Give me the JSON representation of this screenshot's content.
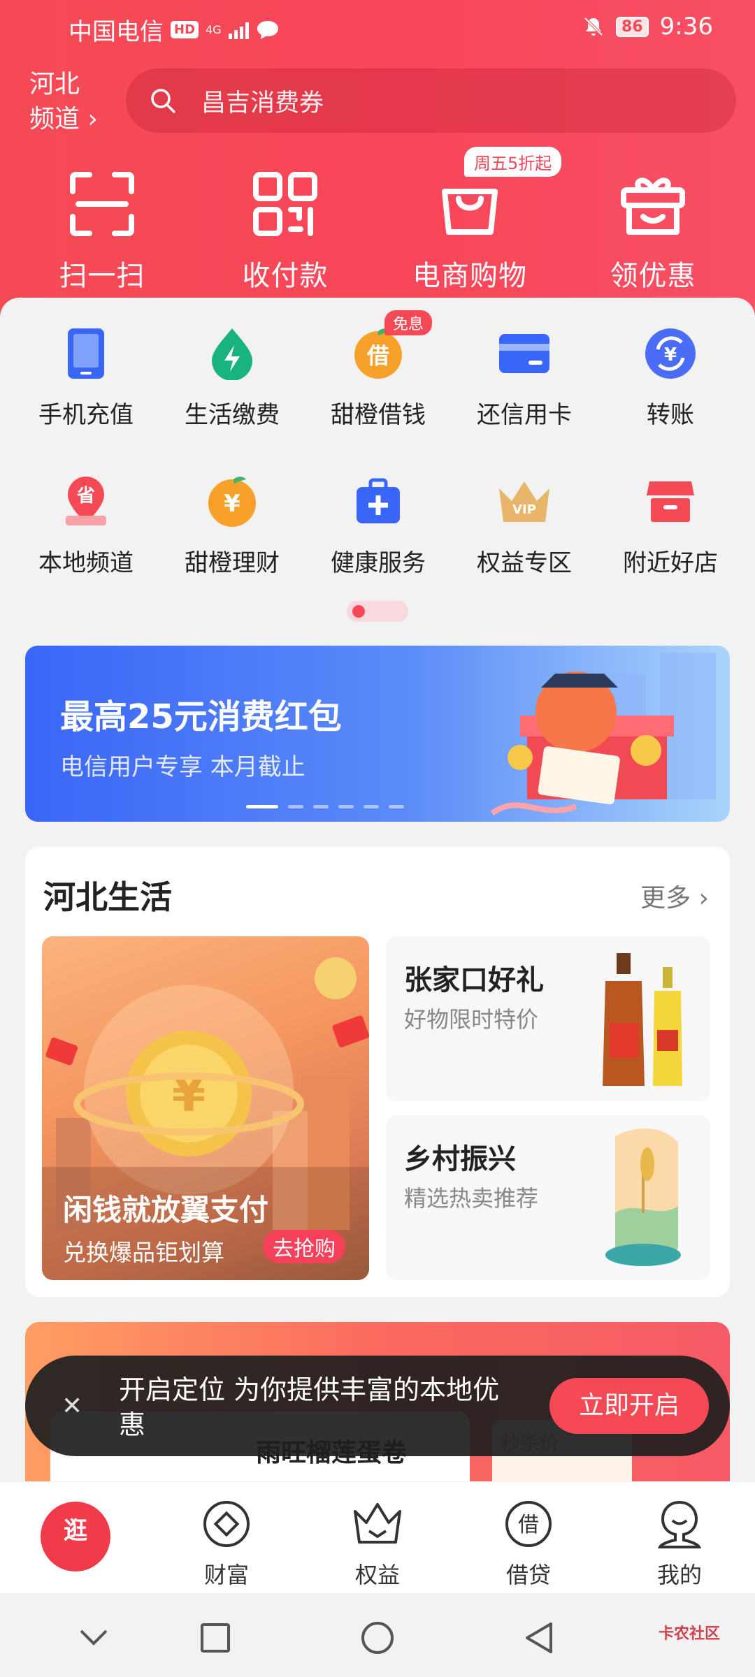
{
  "status_bar": {
    "carrier": "中国电信",
    "hd": "HD",
    "net": "4G",
    "battery": "86",
    "time": "9:36"
  },
  "header": {
    "region_line1": "河北",
    "region_line2": "频道 ›",
    "search_placeholder": "昌吉消费券",
    "actions": [
      {
        "label": "扫一扫",
        "icon": "scan-icon"
      },
      {
        "label": "收付款",
        "icon": "qrcode-icon"
      },
      {
        "label": "电商购物",
        "icon": "shopping-bag-icon"
      },
      {
        "label": "领优惠",
        "icon": "gift-icon"
      }
    ],
    "promo_tag": "周五5折起"
  },
  "grid": {
    "badge": "免息",
    "items": [
      {
        "label": "手机充值",
        "icon": "phone-icon"
      },
      {
        "label": "生活缴费",
        "icon": "bolt-drop-icon"
      },
      {
        "label": "甜橙借钱",
        "icon": "orange-loan-icon"
      },
      {
        "label": "还信用卡",
        "icon": "credit-card-icon"
      },
      {
        "label": "转账",
        "icon": "transfer-icon"
      },
      {
        "label": "本地频道",
        "icon": "local-pin-icon"
      },
      {
        "label": "甜橙理财",
        "icon": "orange-wealth-icon"
      },
      {
        "label": "健康服务",
        "icon": "medical-kit-icon"
      },
      {
        "label": "权益专区",
        "icon": "vip-crown-icon"
      },
      {
        "label": "附近好店",
        "icon": "shop-icon"
      }
    ],
    "loan_badge_char": "借",
    "local_char": "省",
    "wealth_char": "¥"
  },
  "banner": {
    "title": "最高25元消费红包",
    "subtitle": "电信用户专享 本月截止"
  },
  "life": {
    "title": "河北生活",
    "more": "更多 ›",
    "big": {
      "title": "闲钱就放翼支付",
      "subtitle": "兑换爆品钜划算",
      "button": "去抢购"
    },
    "cards": [
      {
        "title": "张家口好礼",
        "subtitle": "好物限时特价"
      },
      {
        "title": "乡村振兴",
        "subtitle": "精选热卖推荐"
      }
    ]
  },
  "flash": {
    "product": "雨旺榴莲蛋卷",
    "seckill_label": "秒杀价"
  },
  "toast": {
    "message": "开启定位 为你提供丰富的本地优惠",
    "button": "立即开启",
    "close": "✕"
  },
  "tabbar": {
    "home": "逛",
    "items": [
      {
        "label": "财富",
        "icon": "wealth-icon"
      },
      {
        "label": "权益",
        "icon": "crown-icon"
      },
      {
        "label": "借贷",
        "icon": "loan-icon"
      },
      {
        "label": "我的",
        "icon": "profile-icon"
      }
    ],
    "loan_char": "借"
  },
  "navbar": {
    "watermark": "卡农社区"
  },
  "colors": {
    "brand_red": "#f54a55",
    "blue": "#3a66f7",
    "orange": "#f7a12a"
  }
}
